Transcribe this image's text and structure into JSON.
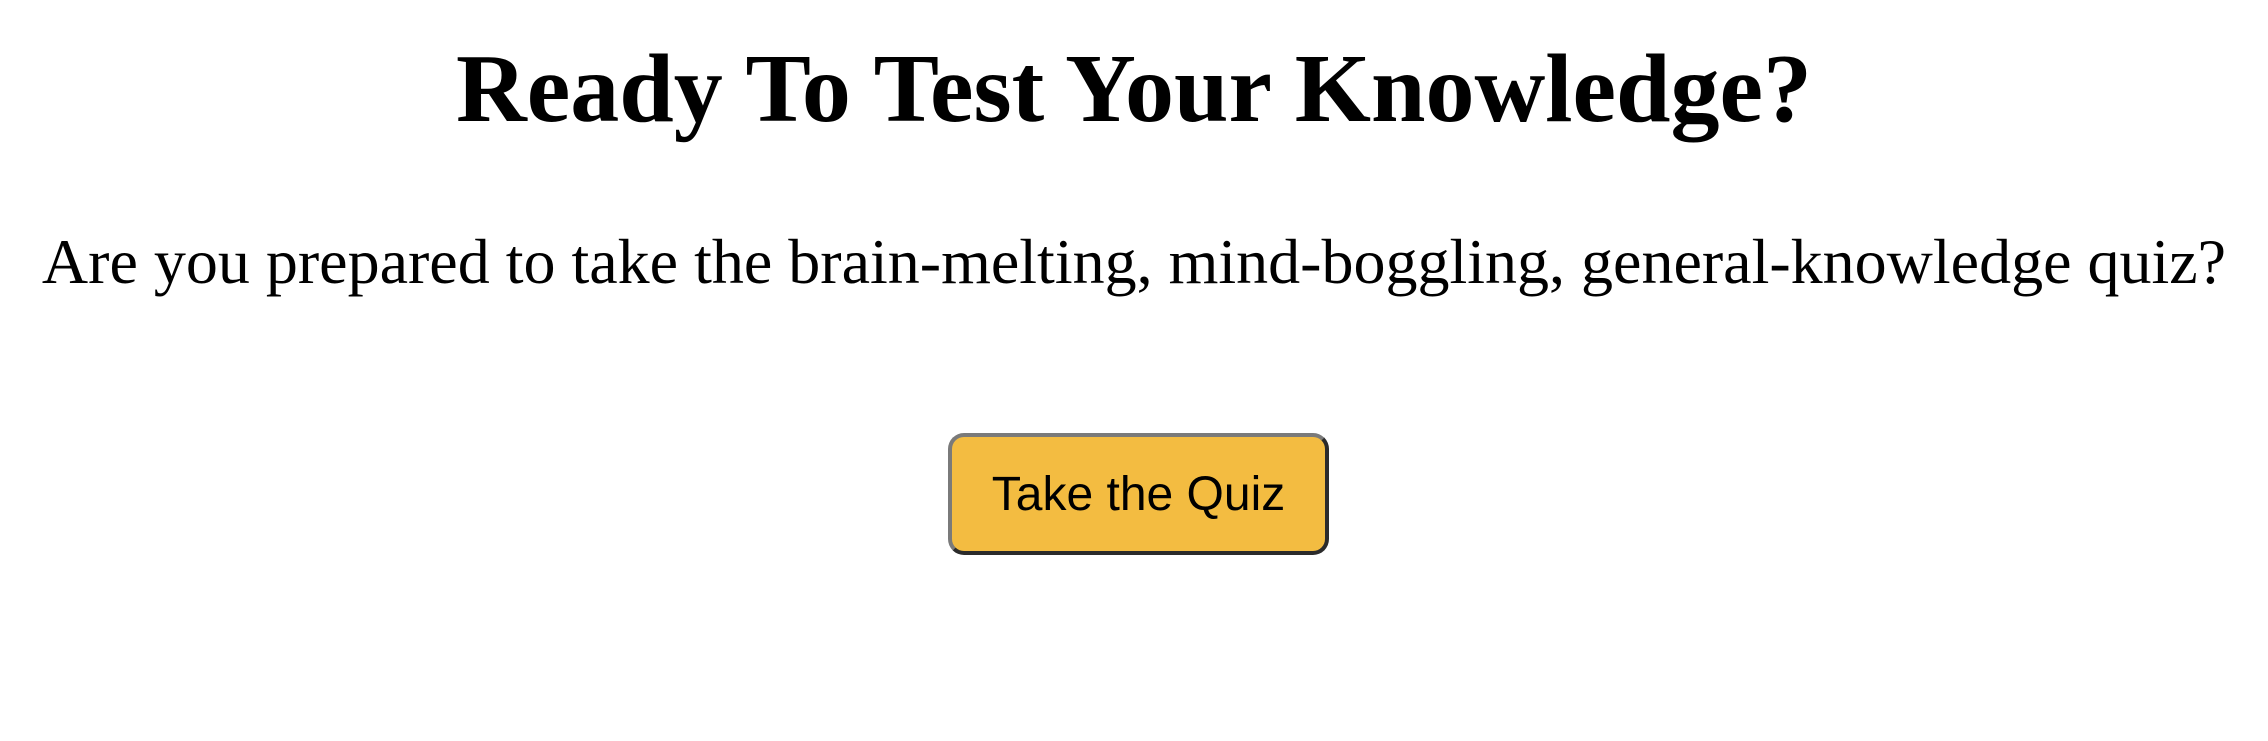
{
  "page": {
    "title": "Ready To Test Your Knowledge?",
    "subtitle": "Are you prepared to take the brain-melting, mind-boggling, general-knowledge quiz?"
  },
  "button": {
    "label": "Take the Quiz"
  },
  "colors": {
    "background": "#ffffff",
    "text": "#000000",
    "button_background": "#f3bc41",
    "button_border_light": "#7a7a7a",
    "button_border_dark": "#2b2b2b"
  }
}
